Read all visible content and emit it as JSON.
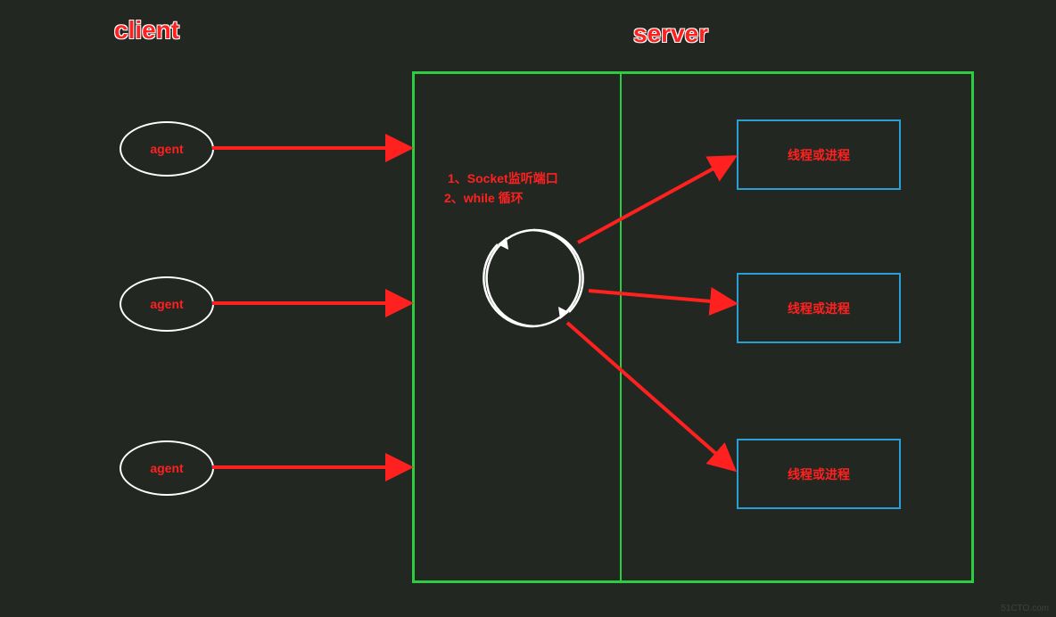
{
  "titles": {
    "client": "client",
    "server": "server"
  },
  "agents": [
    {
      "label": "agent"
    },
    {
      "label": "agent"
    },
    {
      "label": "agent"
    }
  ],
  "notes": {
    "line1": "1、Socket监听端口",
    "line2": "2、while 循环"
  },
  "threads": [
    {
      "label": "线程或进程"
    },
    {
      "label": "线程或进程"
    },
    {
      "label": "线程或进程"
    }
  ],
  "colors": {
    "background": "#222821",
    "accent_red": "#ff2020",
    "border_green": "#2ecc40",
    "border_blue": "#2a9fd6",
    "white": "#ffffff"
  },
  "watermark": "51CTO.com"
}
